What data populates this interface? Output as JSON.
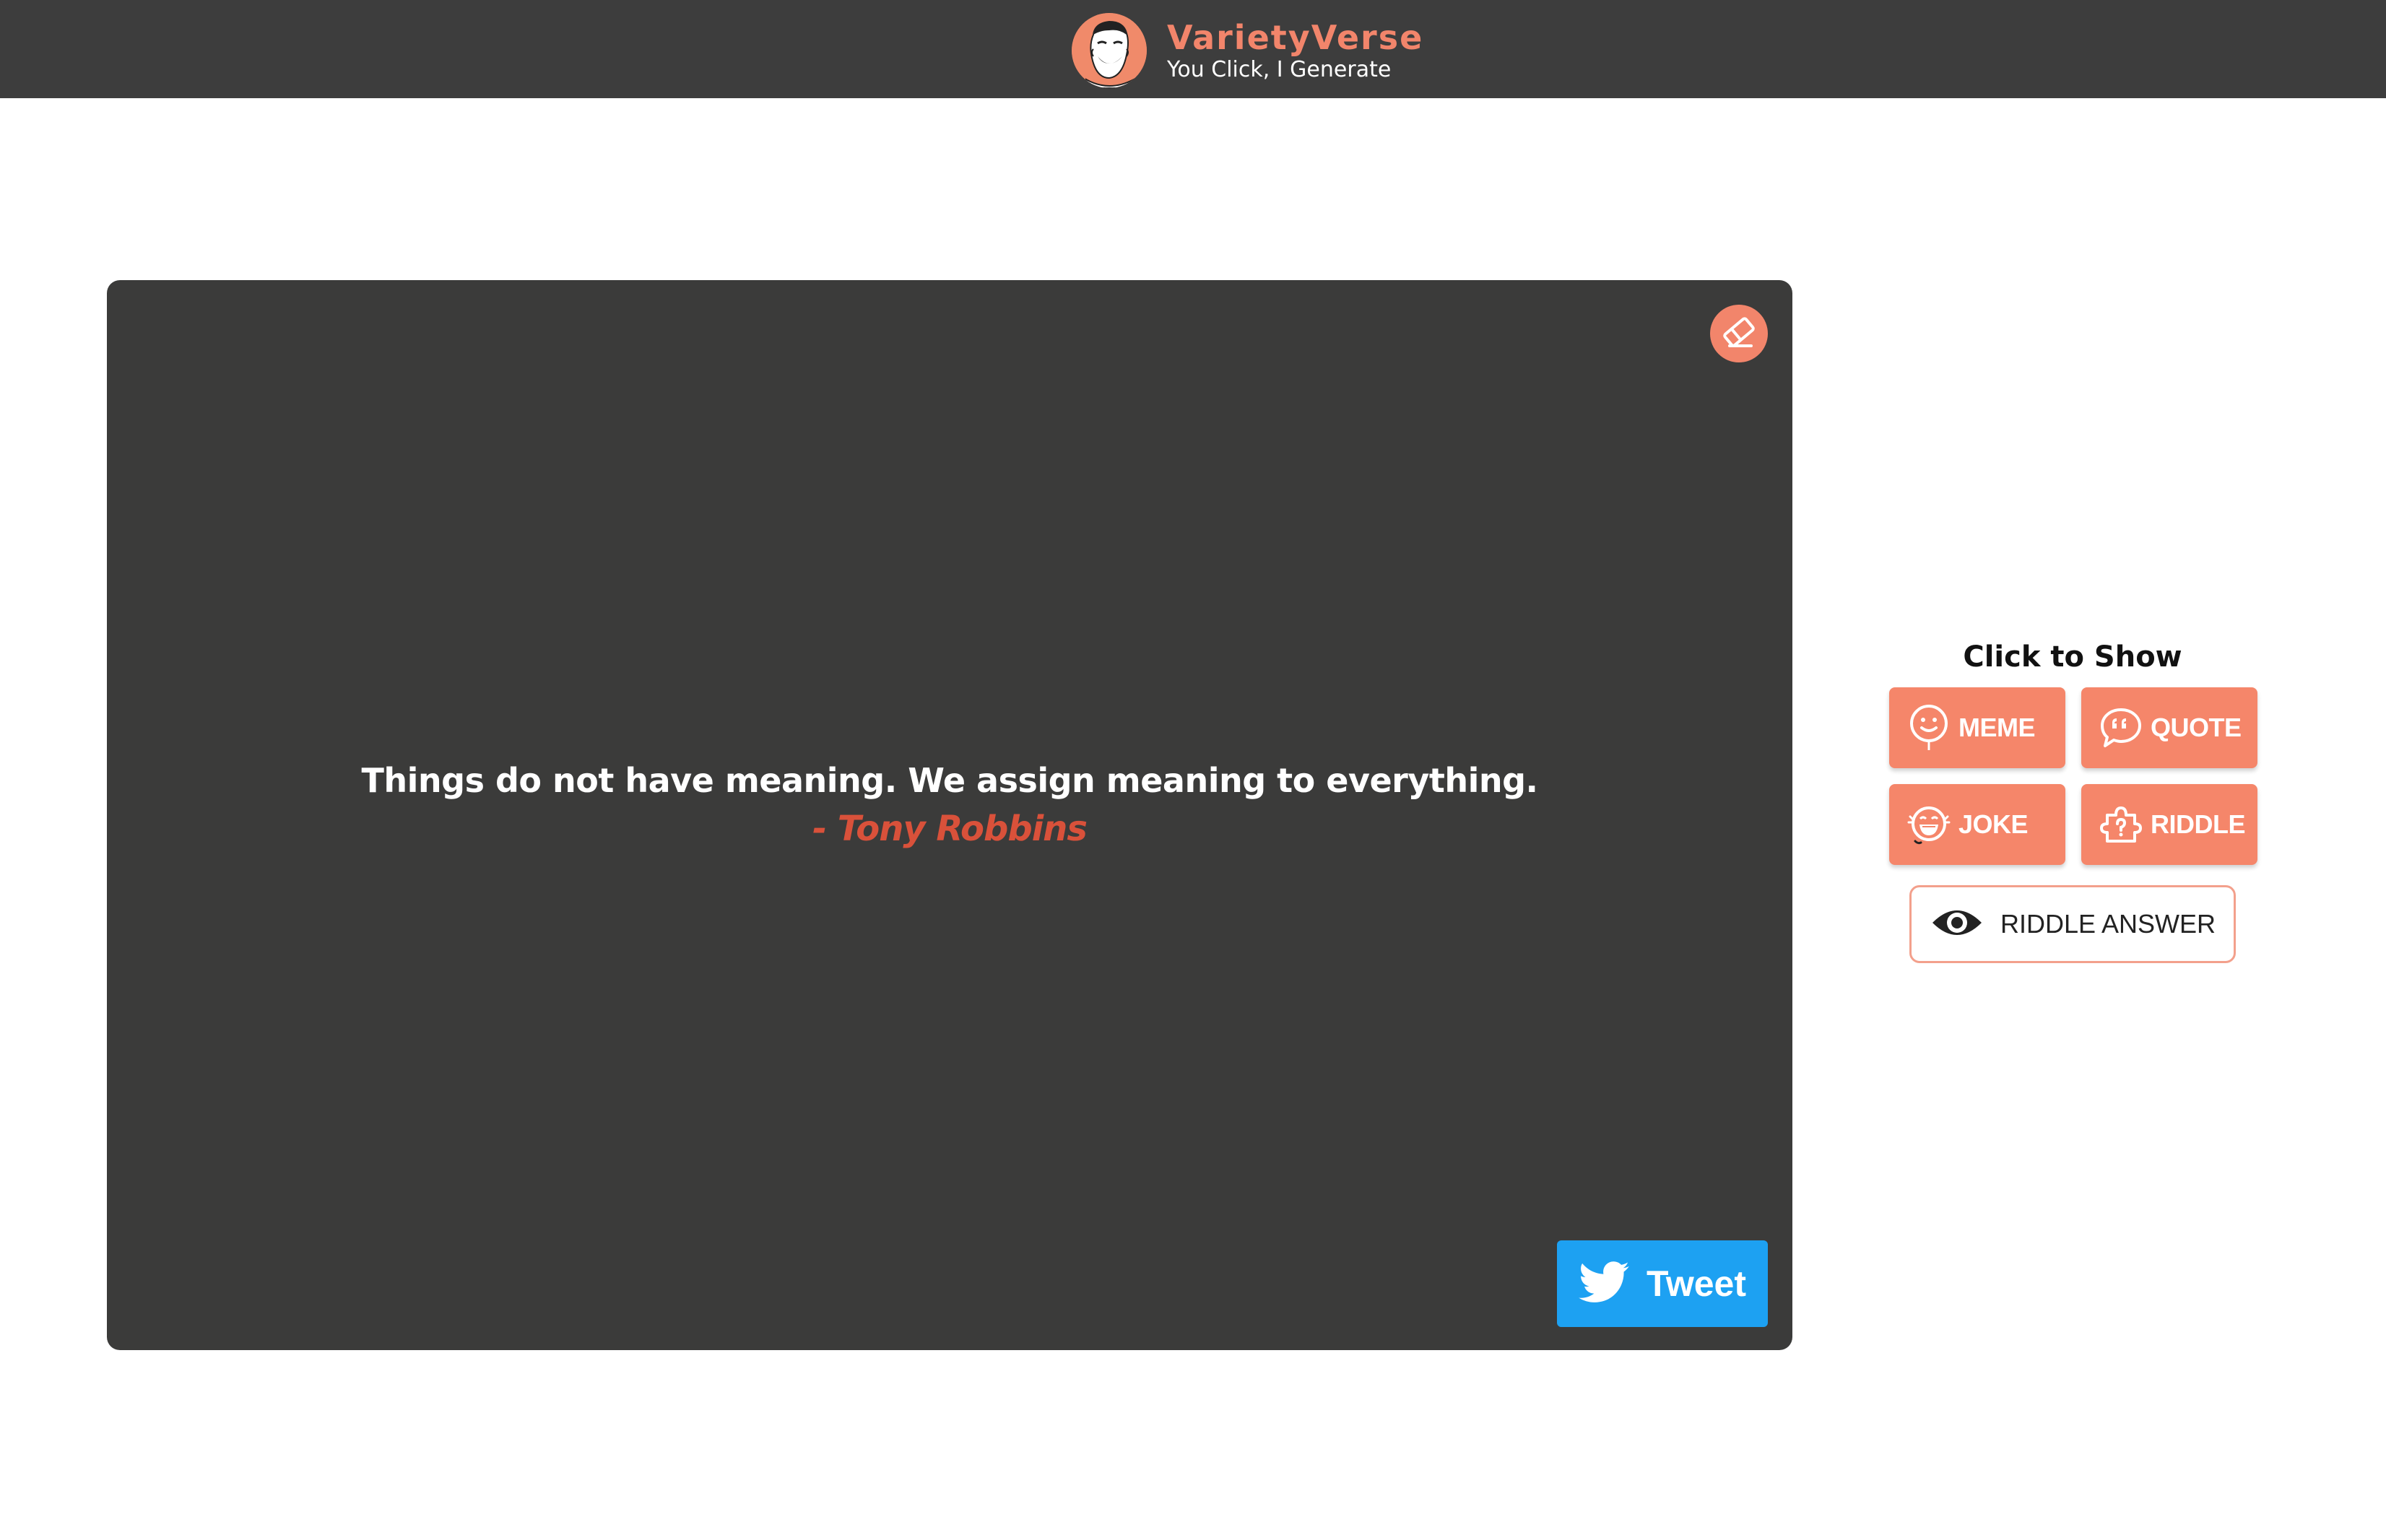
{
  "header": {
    "title": "VarietyVerse",
    "subtitle": "You Click, I Generate",
    "logo_icon": "laughing-face-icon"
  },
  "stage": {
    "clear_icon": "eraser-icon",
    "quote": {
      "text": "Things do not have meaning. We assign meaning to everything.",
      "author": "- Tony Robbins"
    },
    "tweet": {
      "label": "Tweet",
      "icon": "twitter-bird-icon"
    }
  },
  "panel": {
    "title": "Click to Show",
    "buttons": [
      {
        "label": "MEME",
        "icon": "smiley-balloon-icon"
      },
      {
        "label": "QUOTE",
        "icon": "quote-bubble-icon"
      },
      {
        "label": "JOKE",
        "icon": "laughing-face-icon"
      },
      {
        "label": "RIDDLE",
        "icon": "puzzle-question-icon"
      }
    ],
    "answer": {
      "label": "RIDDLE ANSWER",
      "icon": "eye-icon"
    }
  },
  "colors": {
    "accent": "#f5866a",
    "header_bg": "#3d3d3d",
    "stage_bg": "#3b3b3a",
    "author": "#d9513a",
    "twitter": "#1da1f2"
  }
}
